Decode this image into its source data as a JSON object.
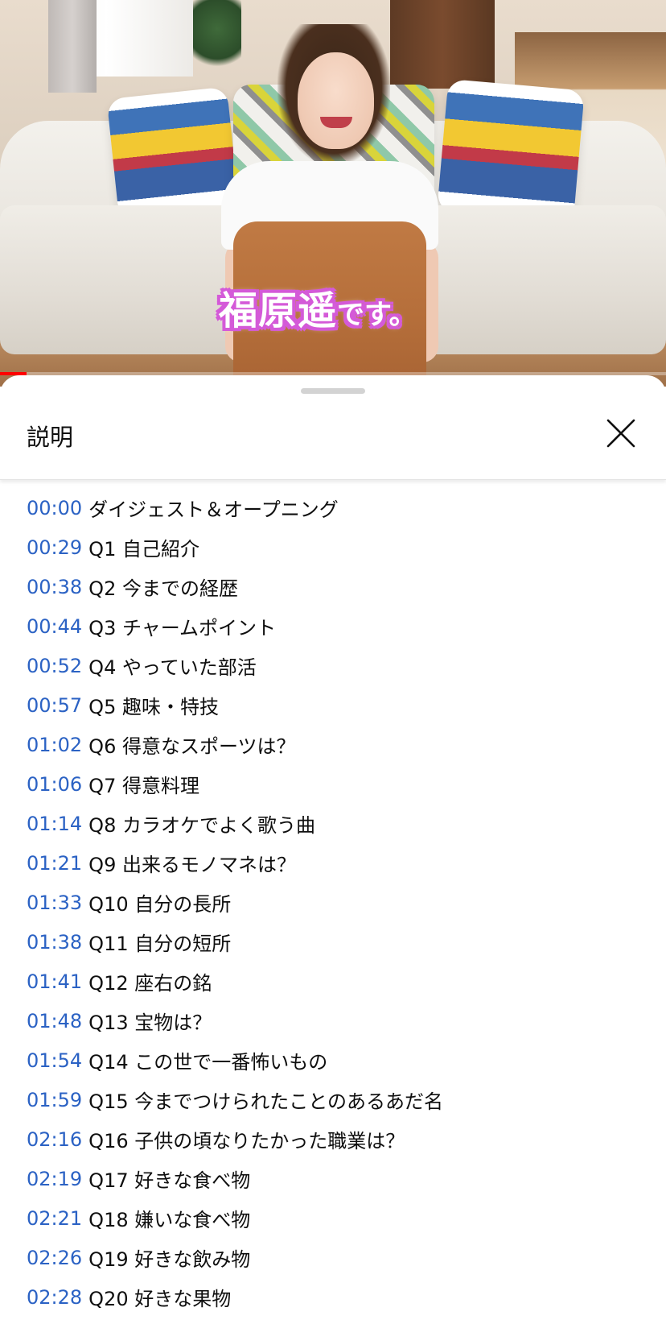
{
  "video": {
    "caption_main": "福原遥",
    "caption_tail": "です。",
    "progress": 0.04,
    "accent_color": "#ff0000"
  },
  "panel": {
    "title": "説明",
    "close_icon": "close-icon"
  },
  "chapters": [
    {
      "time": "00:00",
      "text": "ダイジェスト＆オープニング"
    },
    {
      "time": "00:29",
      "text": "Q1 自己紹介"
    },
    {
      "time": "00:38",
      "text": "Q2 今までの経歴"
    },
    {
      "time": "00:44",
      "text": "Q3 チャームポイント"
    },
    {
      "time": "00:52",
      "text": "Q4 やっていた部活"
    },
    {
      "time": "00:57",
      "text": "Q5 趣味・特技"
    },
    {
      "time": "01:02",
      "text": "Q6 得意なスポーツは？"
    },
    {
      "time": "01:06",
      "text": "Q7 得意料理"
    },
    {
      "time": "01:14",
      "text": "Q8 カラオケでよく歌う曲"
    },
    {
      "time": "01:21",
      "text": "Q9 出来るモノマネは？"
    },
    {
      "time": "01:33",
      "text": "Q10 自分の長所"
    },
    {
      "time": "01:38",
      "text": "Q11 自分の短所"
    },
    {
      "time": "01:41",
      "text": "Q12 座右の銘"
    },
    {
      "time": "01:48",
      "text": "Q13 宝物は？"
    },
    {
      "time": "01:54",
      "text": "Q14 この世で一番怖いもの"
    },
    {
      "time": "01:59",
      "text": "Q15 今までつけられたことのあるあだ名"
    },
    {
      "time": "02:16",
      "text": "Q16 子供の頃なりたかった職業は？"
    },
    {
      "time": "02:19",
      "text": "Q17 好きな食べ物"
    },
    {
      "time": "02:21",
      "text": "Q18 嫌いな食べ物"
    },
    {
      "time": "02:26",
      "text": "Q19 好きな飲み物"
    },
    {
      "time": "02:28",
      "text": "Q20 好きな果物"
    }
  ]
}
